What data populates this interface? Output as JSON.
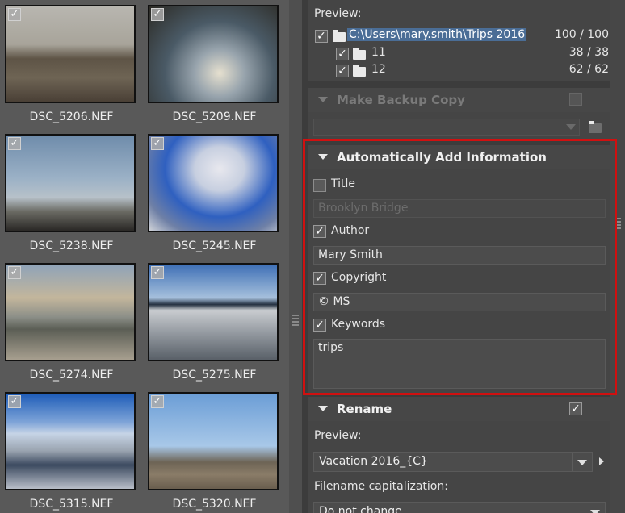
{
  "thumbnails": [
    {
      "name": "DSC_5206.NEF",
      "checked": true
    },
    {
      "name": "DSC_5209.NEF",
      "checked": true
    },
    {
      "name": "DSC_5238.NEF",
      "checked": true
    },
    {
      "name": "DSC_5245.NEF",
      "checked": true
    },
    {
      "name": "DSC_5274.NEF",
      "checked": true
    },
    {
      "name": "DSC_5275.NEF",
      "checked": true
    },
    {
      "name": "DSC_5315.NEF",
      "checked": true
    },
    {
      "name": "DSC_5320.NEF",
      "checked": true
    }
  ],
  "preview": {
    "label": "Preview:",
    "root": {
      "path": "C:\\Users\\mary.smith\\Trips 2016",
      "count": "100 / 100",
      "checked": true
    },
    "children": [
      {
        "name": "11",
        "count": "38 / 38",
        "checked": true
      },
      {
        "name": "12",
        "count": "62 / 62",
        "checked": true
      }
    ]
  },
  "backup": {
    "title": "Make Backup Copy",
    "checked": false
  },
  "auto_info": {
    "title": "Automatically Add Information",
    "title_field": {
      "label": "Title",
      "checked": false,
      "value": "Brooklyn Bridge"
    },
    "author_field": {
      "label": "Author",
      "checked": true,
      "value": "Mary Smith"
    },
    "copyright_field": {
      "label": "Copyright",
      "checked": true,
      "value": "© MS"
    },
    "keywords_field": {
      "label": "Keywords",
      "checked": true,
      "value": "trips"
    }
  },
  "rename": {
    "title": "Rename",
    "checked": true,
    "preview_label": "Preview:",
    "preview_value": "Vacation 2016_{C}",
    "capitalization_label": "Filename capitalization:",
    "capitalization_value": "Do not change"
  },
  "colors": {
    "highlight": "#d01010",
    "selection": "#4a6d96"
  },
  "glyphs": {
    "check": "✓"
  }
}
